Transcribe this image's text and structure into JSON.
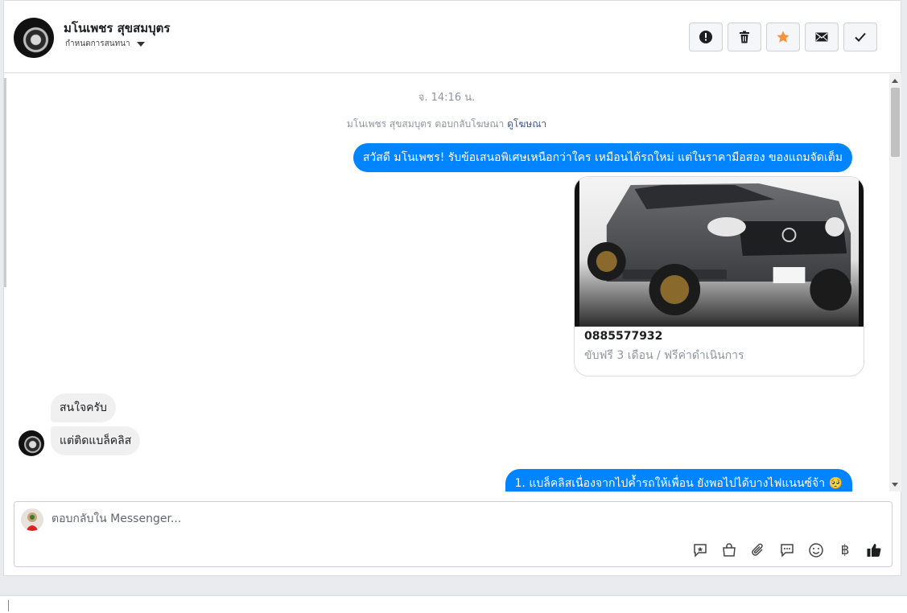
{
  "header": {
    "contact_name": "มโนเพชร สุขสมบุตร",
    "assign_label": "กำหนดการสนทนา",
    "actions": [
      {
        "name": "report-icon"
      },
      {
        "name": "trash-icon"
      },
      {
        "name": "star-icon",
        "color": "#f7923b"
      },
      {
        "name": "mail-icon"
      },
      {
        "name": "check-icon"
      }
    ]
  },
  "conversation": {
    "timestamp": "จ. 14:16 น.",
    "ad_reply_note": "มโนเพชร สุขสมบุตร ตอบกลับโฆษณา",
    "ad_reply_link": "ดูโฆษณา",
    "messages": {
      "out_greeting": "สวัสดี มโนเพชร! รับข้อเสนอพิเศษเหนือกว่าใคร เหมือนได้รถใหม่ แต่ในราคามือสอง ของแถมจัดเต็ม",
      "card_title": "0885577932",
      "card_subtitle": "ขับฟรี 3 เดือน / ฟรีค่าดำเนินการ",
      "in_1": "สนใจครับ",
      "in_2": "แต่ติดแบล็คลิส",
      "out_reply": "1. แบล็คลิสเนื่องจากไปค้ำรถให้เพื่อน ยังพอไปได้บางไฟแนนซ์จ้า 🥺"
    }
  },
  "composer": {
    "placeholder": "ตอบกลับใน Messenger...",
    "tools": [
      "saved-reply-icon",
      "shop-icon",
      "attach-icon",
      "chat-icon",
      "emoji-icon",
      "baht-icon",
      "like-icon"
    ],
    "baht_symbol": "฿"
  },
  "colors": {
    "outgoing_bubble": "#0084ff",
    "incoming_bubble": "#f1f0f0",
    "link": "#385898"
  }
}
